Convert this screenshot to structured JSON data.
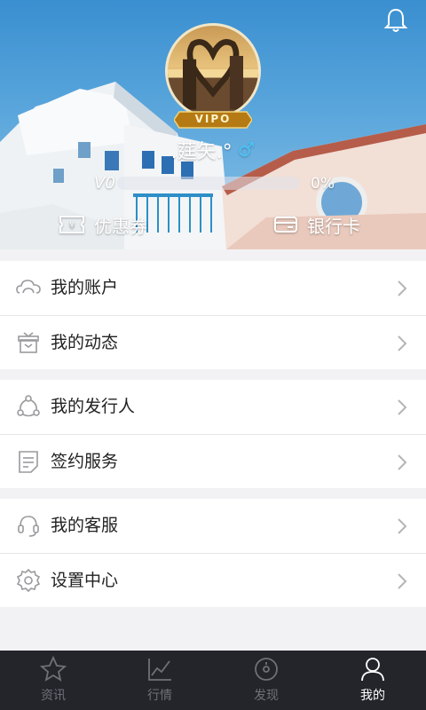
{
  "profile": {
    "username": ".莛矢.°",
    "gender_symbol": "♂",
    "vip_badge_text": "VIPO",
    "level_label": "V0",
    "progress_text": "0%",
    "progress_fraction": 0
  },
  "quick_actions": {
    "coupon_label": "优惠券",
    "bank_card_label": "银行卡"
  },
  "menu": {
    "groups": [
      {
        "items": [
          {
            "label": "我的账户",
            "icon": "cloud-icon"
          },
          {
            "label": "我的动态",
            "icon": "gift-box-icon"
          }
        ]
      },
      {
        "items": [
          {
            "label": "我的发行人",
            "icon": "share-nodes-icon"
          },
          {
            "label": "签约服务",
            "icon": "document-icon"
          }
        ]
      },
      {
        "items": [
          {
            "label": "我的客服",
            "icon": "headset-icon"
          },
          {
            "label": "设置中心",
            "icon": "gear-icon"
          }
        ]
      }
    ]
  },
  "tabbar": {
    "tabs": [
      {
        "label": "资讯",
        "icon": "star-icon",
        "active": false
      },
      {
        "label": "行情",
        "icon": "chart-line-icon",
        "active": false
      },
      {
        "label": "发现",
        "icon": "compass-icon",
        "active": false
      },
      {
        "label": "我的",
        "icon": "person-icon",
        "active": true
      }
    ]
  },
  "colors": {
    "accent_gender": "#4cc1f5",
    "tabbar_bg": "#23252b",
    "tab_inactive": "#6f7178",
    "tab_active": "#ffffff"
  }
}
